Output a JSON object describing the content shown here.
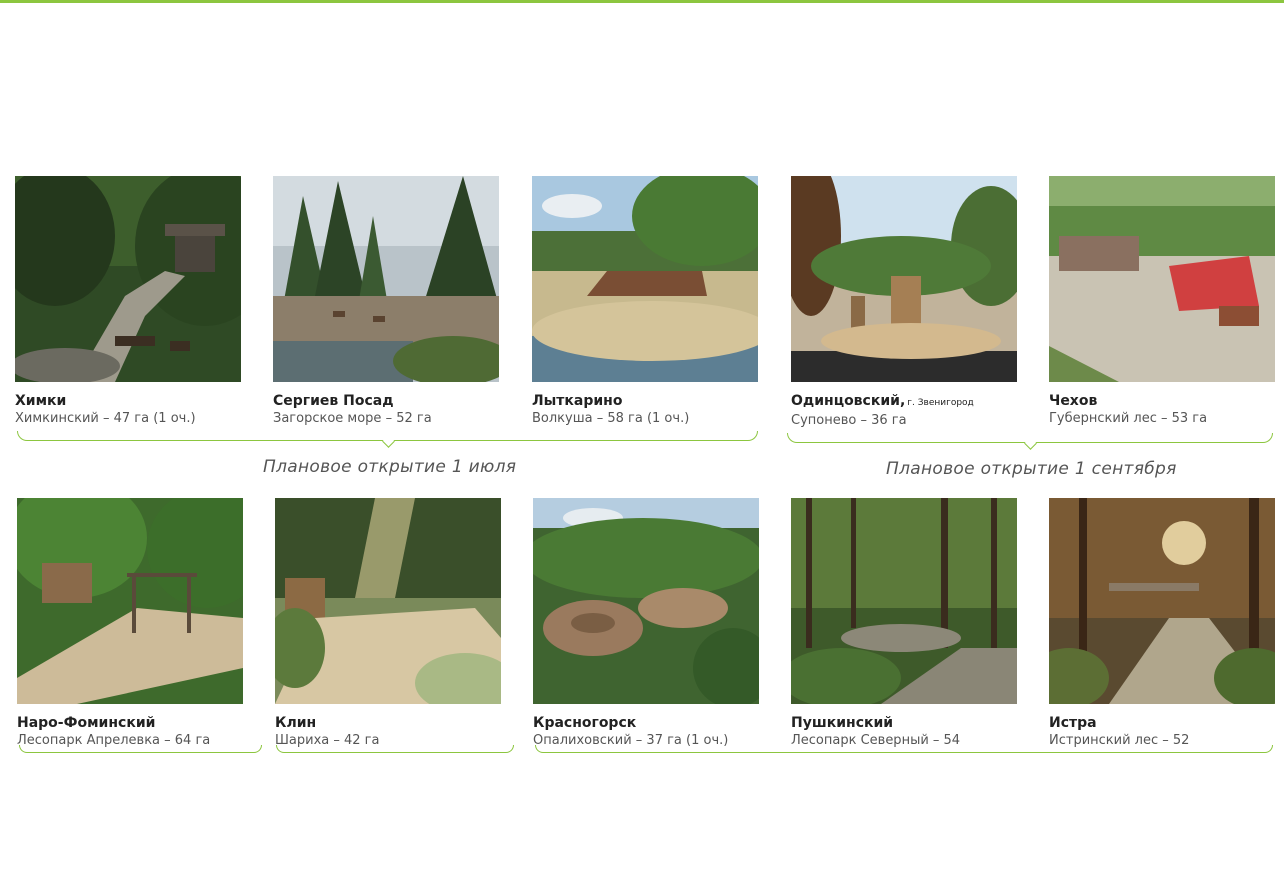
{
  "colors": {
    "accent": "#8cc63f"
  },
  "openings": [
    "Плановое открытие 1 июля",
    "Плановое открытие 1 сентября"
  ],
  "parks": [
    {
      "city": "Химки",
      "city_sub": "",
      "park": "Химкинский – 47 га (1 оч.)"
    },
    {
      "city": "Сергиев Посад",
      "city_sub": "",
      "park": "Загорское море – 52 га"
    },
    {
      "city": "Лыткарино",
      "city_sub": "",
      "park": "Волкуша – 58 га (1 оч.)"
    },
    {
      "city": "Одинцовский,",
      "city_sub": "г. Звенигород",
      "park": "Супонево – 36 га"
    },
    {
      "city": "Чехов",
      "city_sub": "",
      "park": "Губернский лес – 53 га"
    },
    {
      "city": "Наро-Фоминский",
      "city_sub": "",
      "park": "Лесопарк Апрелевка – 64 га"
    },
    {
      "city": "Клин",
      "city_sub": "",
      "park": "Шариха – 42 га"
    },
    {
      "city": "Красногорск",
      "city_sub": "",
      "park": "Опалиховский – 37 га (1 оч.)"
    },
    {
      "city": "Пушкинский",
      "city_sub": "",
      "park": "Лесопарк Северный – 54"
    },
    {
      "city": "Истра",
      "city_sub": "",
      "park": "Истринский лес – 52"
    }
  ]
}
